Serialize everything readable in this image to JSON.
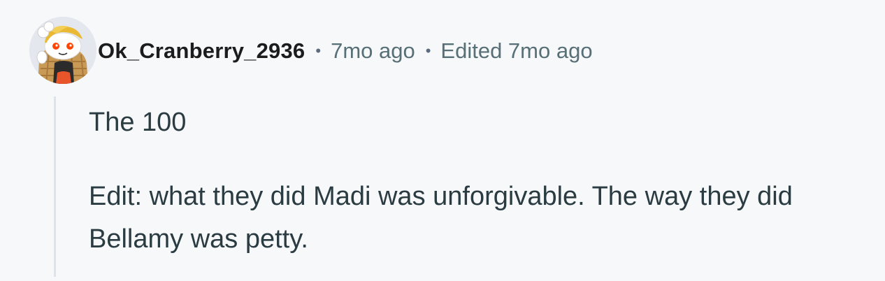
{
  "comment": {
    "author": "Ok_Cranberry_2936",
    "separator": "•",
    "timestamp": "7mo ago",
    "edited": "Edited 7mo ago",
    "paragraphs": [
      "The 100",
      "Edit: what they did Madi was unforgivable. The way they did Bellamy was petty."
    ]
  },
  "icons": {
    "avatar": "snoo-avatar-icon"
  },
  "colors": {
    "background": "#f7f8fa",
    "username": "#1c1c1c",
    "meta": "#576f76",
    "body": "#2a3c42",
    "thread_line": "#dde3ea"
  }
}
